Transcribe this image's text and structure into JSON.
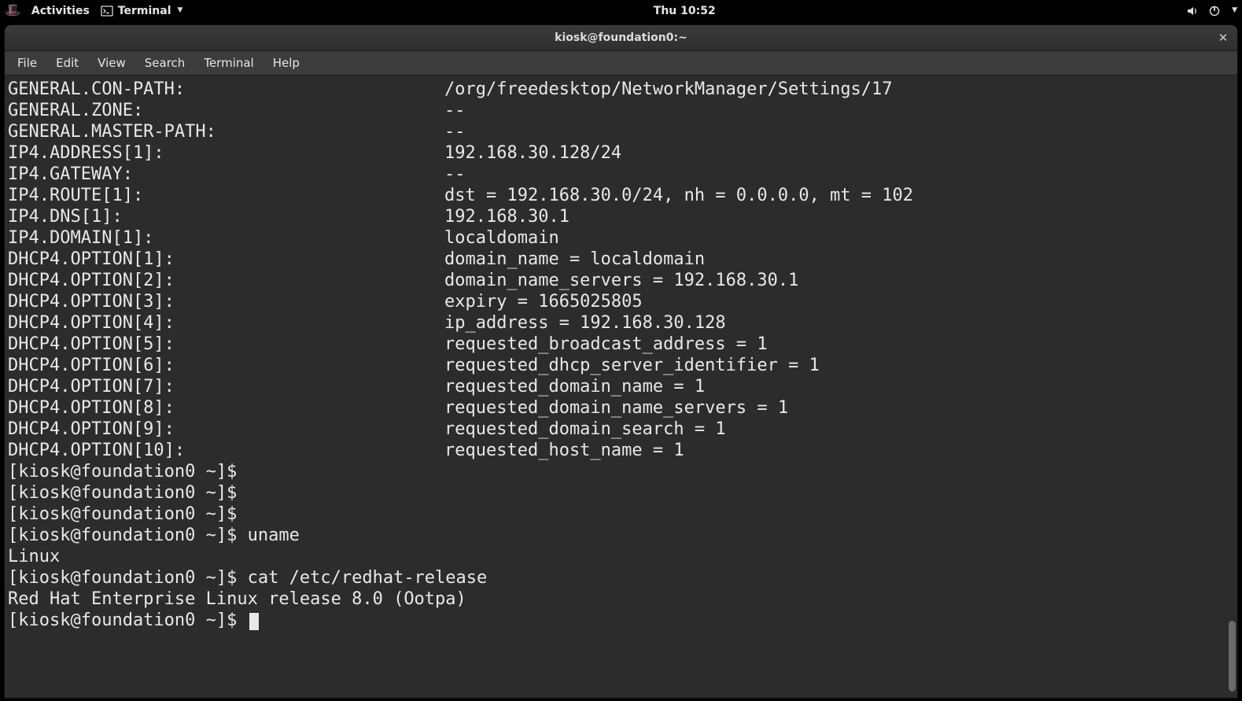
{
  "panel": {
    "activities": "Activities",
    "app_name": "Terminal",
    "clock": "Thu 10:52"
  },
  "window": {
    "title": "kiosk@foundation0:~"
  },
  "menubar": {
    "items": [
      "File",
      "Edit",
      "View",
      "Search",
      "Terminal",
      "Help"
    ]
  },
  "kv_lines": [
    {
      "key": "GENERAL.CON-PATH:",
      "value": "/org/freedesktop/NetworkManager/Settings/17"
    },
    {
      "key": "GENERAL.ZONE:",
      "value": "--"
    },
    {
      "key": "GENERAL.MASTER-PATH:",
      "value": "--"
    },
    {
      "key": "IP4.ADDRESS[1]:",
      "value": "192.168.30.128/24"
    },
    {
      "key": "IP4.GATEWAY:",
      "value": "--"
    },
    {
      "key": "IP4.ROUTE[1]:",
      "value": "dst = 192.168.30.0/24, nh = 0.0.0.0, mt = 102"
    },
    {
      "key": "IP4.DNS[1]:",
      "value": "192.168.30.1"
    },
    {
      "key": "IP4.DOMAIN[1]:",
      "value": "localdomain"
    },
    {
      "key": "DHCP4.OPTION[1]:",
      "value": "domain_name = localdomain"
    },
    {
      "key": "DHCP4.OPTION[2]:",
      "value": "domain_name_servers = 192.168.30.1"
    },
    {
      "key": "DHCP4.OPTION[3]:",
      "value": "expiry = 1665025805"
    },
    {
      "key": "DHCP4.OPTION[4]:",
      "value": "ip_address = 192.168.30.128"
    },
    {
      "key": "DHCP4.OPTION[5]:",
      "value": "requested_broadcast_address = 1"
    },
    {
      "key": "DHCP4.OPTION[6]:",
      "value": "requested_dhcp_server_identifier = 1"
    },
    {
      "key": "DHCP4.OPTION[7]:",
      "value": "requested_domain_name = 1"
    },
    {
      "key": "DHCP4.OPTION[8]:",
      "value": "requested_domain_name_servers = 1"
    },
    {
      "key": "DHCP4.OPTION[9]:",
      "value": "requested_domain_search = 1"
    },
    {
      "key": "DHCP4.OPTION[10]:",
      "value": "requested_host_name = 1"
    }
  ],
  "tail_lines": [
    "[kiosk@foundation0 ~]$ ",
    "[kiosk@foundation0 ~]$ ",
    "[kiosk@foundation0 ~]$ ",
    "[kiosk@foundation0 ~]$ uname",
    "Linux",
    "[kiosk@foundation0 ~]$ cat /etc/redhat-release",
    "Red Hat Enterprise Linux release 8.0 (Ootpa)"
  ],
  "prompt_last": "[kiosk@foundation0 ~]$ "
}
